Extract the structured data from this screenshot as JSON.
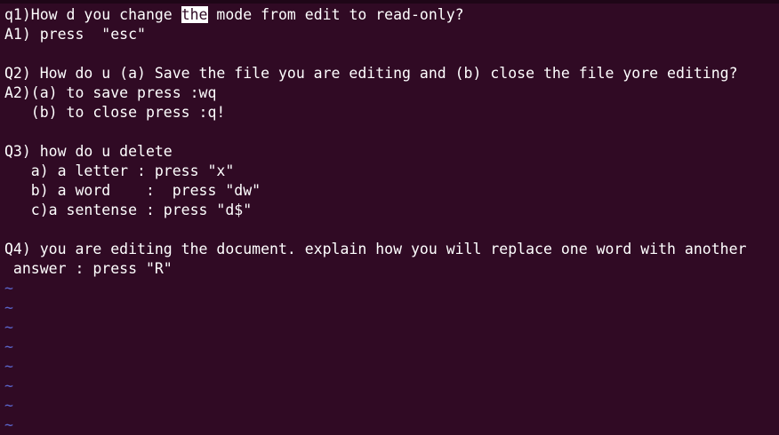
{
  "buffer": {
    "lines": [
      {
        "before": "q1)How d you change ",
        "highlight": "the",
        "after": " mode from edit to read-only?"
      },
      {
        "text": "A1) press  \"esc\""
      },
      {
        "text": ""
      },
      {
        "text": "Q2) How do u (a) Save the file you are editing and (b) close the file yore editing?"
      },
      {
        "text": "A2)(a) to save press :wq"
      },
      {
        "text": "   (b) to close press :q!"
      },
      {
        "text": ""
      },
      {
        "text": "Q3) how do u delete"
      },
      {
        "text": "   a) a letter : press \"x\""
      },
      {
        "text": "   b) a word    :  press \"dw\""
      },
      {
        "text": "   c)a sentense : press \"d$\""
      },
      {
        "text": ""
      },
      {
        "text": "Q4) you are editing the document. explain how you will replace one word with another"
      },
      {
        "text": " answer : press \"R\""
      }
    ],
    "empty_line_marker": "~"
  },
  "colors": {
    "background": "#300a24",
    "text": "#ffffff",
    "tilde": "#5a64c8",
    "search_highlight_bg": "#ffffff",
    "search_highlight_fg": "#300a24"
  }
}
